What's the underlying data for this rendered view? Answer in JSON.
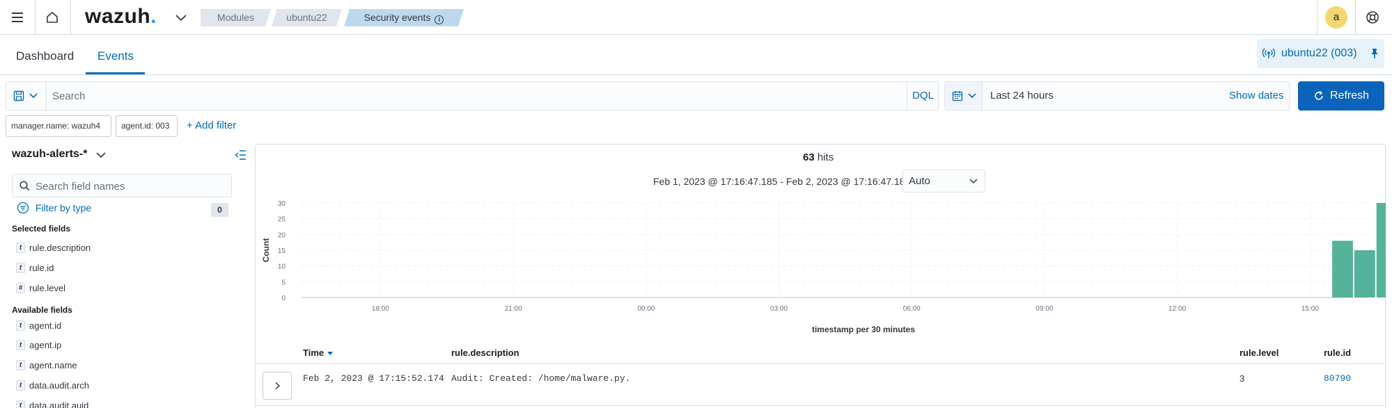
{
  "header": {
    "logo_text": "wazuh",
    "logo_dot": ".",
    "breadcrumbs": [
      "Modules",
      "ubuntu22",
      "Security events"
    ],
    "avatar_initial": "a"
  },
  "tabs": [
    {
      "label": "Dashboard",
      "active": false
    },
    {
      "label": "Events",
      "active": true
    }
  ],
  "agent_pill": {
    "label": "ubuntu22 (003)"
  },
  "query": {
    "search_placeholder": "Search",
    "language": "DQL",
    "date_range_label": "Last 24 hours",
    "show_dates": "Show dates",
    "refresh_label": "Refresh"
  },
  "filters": [
    "manager.name: wazuh4",
    "agent.id: 003"
  ],
  "add_filter_label": "+ Add filter",
  "sidebar": {
    "index_pattern": "wazuh-alerts-*",
    "field_search_placeholder": "Search field names",
    "filter_by_type": "Filter by type",
    "filter_count": "0",
    "selected_label": "Selected fields",
    "selected_fields": [
      {
        "type": "t",
        "name": "rule.description"
      },
      {
        "type": "t",
        "name": "rule.id"
      },
      {
        "type": "#",
        "name": "rule.level"
      }
    ],
    "available_label": "Available fields",
    "available_fields": [
      {
        "type": "t",
        "name": "agent.id"
      },
      {
        "type": "t",
        "name": "agent.ip"
      },
      {
        "type": "t",
        "name": "agent.name"
      },
      {
        "type": "t",
        "name": "data.audit.arch"
      },
      {
        "type": "t",
        "name": "data.audit.auid"
      }
    ]
  },
  "results": {
    "hits_count": "63",
    "hits_label": "hits",
    "date_range": "Feb 1, 2023 @ 17:16:47.185 - Feb 2, 2023 @ 17:16:47.185",
    "interval": "Auto"
  },
  "chart_data": {
    "type": "bar",
    "xlabel": "timestamp per 30 minutes",
    "ylabel": "Count",
    "ylim": [
      0,
      30
    ],
    "yticks": [
      0,
      5,
      10,
      15,
      20,
      25,
      30
    ],
    "xticks": [
      "18:00",
      "21:00",
      "00:00",
      "03:00",
      "06:00",
      "09:00",
      "12:00",
      "15:00"
    ],
    "x_range_hours": [
      16.2,
      40.3
    ],
    "xtick_hours": [
      18,
      21,
      24,
      27,
      30,
      33,
      36,
      39
    ],
    "bars": [
      {
        "start_hour": 39.5,
        "value": 18
      },
      {
        "start_hour": 40.0,
        "value": 15
      },
      {
        "start_hour": 40.5,
        "value": 30
      }
    ],
    "current_time_hour": 40.78,
    "bar_color": "#54b399",
    "marker_color": "#bd271e",
    "grid": true
  },
  "table": {
    "columns": [
      "Time",
      "rule.description",
      "rule.level",
      "rule.id"
    ],
    "rows": [
      {
        "time": "Feb 2, 2023 @ 17:15:52.174",
        "description": "Audit: Created: /home/malware.py.",
        "level": "3",
        "id": "80790"
      }
    ]
  },
  "colors": {
    "accent": "#006bb8",
    "refresh_bg": "#0b64b9",
    "breadcrumb_active": "#bed9ee",
    "avatar": "#f1d86f"
  }
}
